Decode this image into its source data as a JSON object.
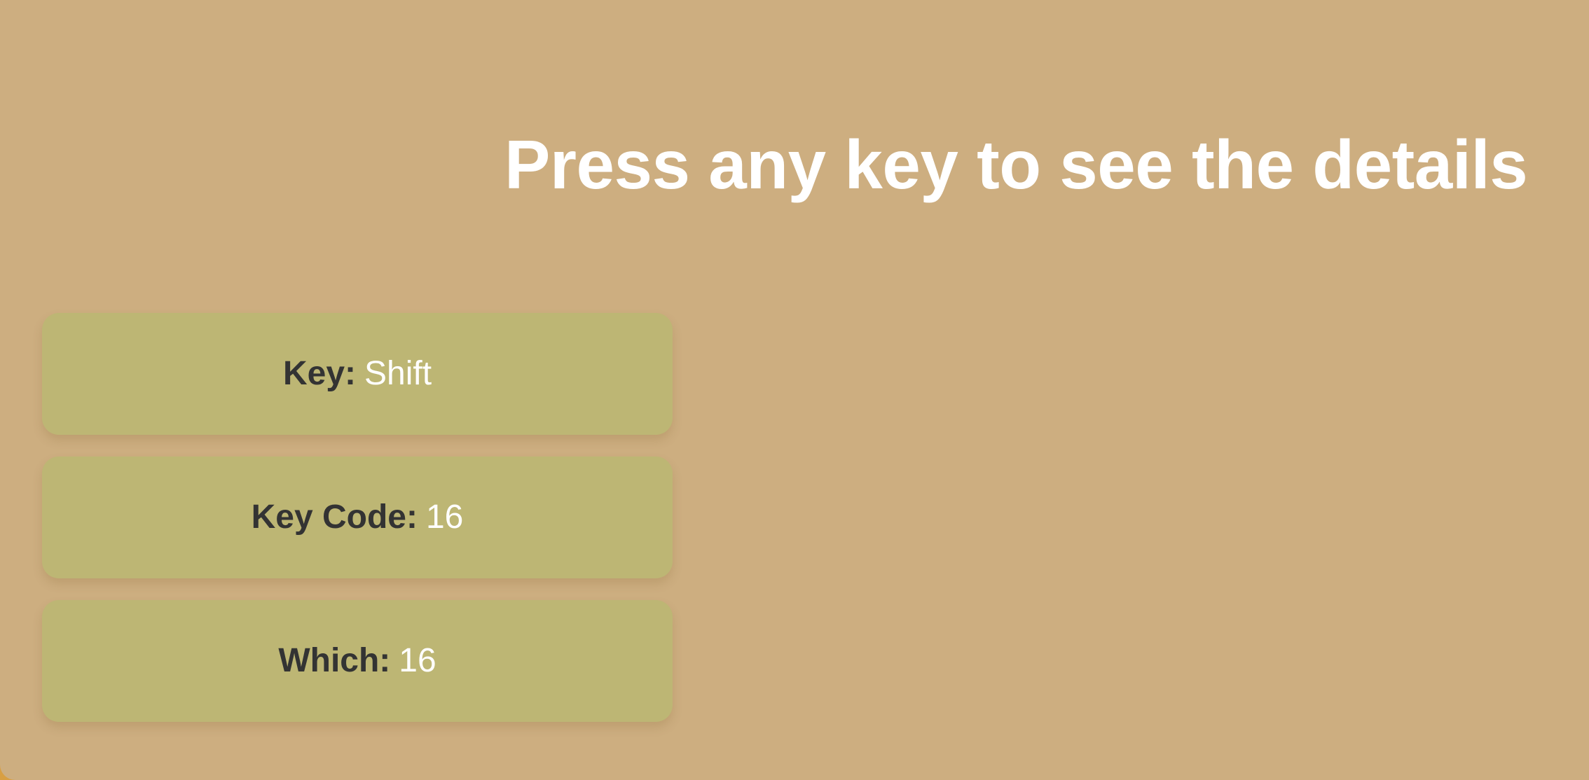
{
  "heading": {
    "text": "Press any key to see the details"
  },
  "details": [
    {
      "label": "Key:",
      "value": "Shift"
    },
    {
      "label": "Key Code:",
      "value": "16"
    },
    {
      "label": "Which:",
      "value": "16"
    }
  ],
  "colors": {
    "page_background": "#cdae80",
    "outer_frame": "#d89f42",
    "card_background": "#bdb674",
    "label_text": "#333333",
    "value_text": "#ffffff",
    "heading_text": "#ffffff"
  }
}
